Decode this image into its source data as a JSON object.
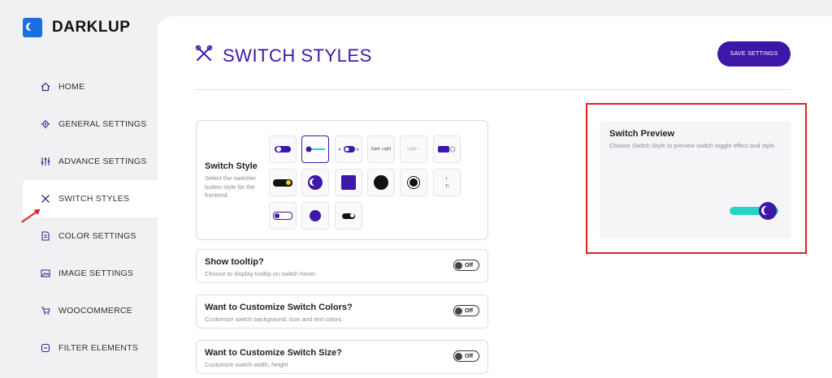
{
  "brand": {
    "name": "DARKLUP",
    "accent": "#3d17a8",
    "logo_color": "#1a6fe0"
  },
  "sidebar": {
    "items": [
      {
        "label": "HOME",
        "icon": "home-icon"
      },
      {
        "label": "GENERAL SETTINGS",
        "icon": "gear-icon"
      },
      {
        "label": "ADVANCE SETTINGS",
        "icon": "sliders-icon"
      },
      {
        "label": "SWITCH STYLES",
        "icon": "tools-icon",
        "active": true
      },
      {
        "label": "COLOR SETTINGS",
        "icon": "palette-icon"
      },
      {
        "label": "IMAGE SETTINGS",
        "icon": "image-icon"
      },
      {
        "label": "WOOCOMMERCE",
        "icon": "cart-icon"
      },
      {
        "label": "FILTER ELEMENTS",
        "icon": "filter-icon"
      }
    ]
  },
  "header": {
    "title": "SWITCH STYLES",
    "save_label": "SAVE SETTINGS"
  },
  "switch_style": {
    "title": "Switch Style",
    "description": "Select the switcher button style for the frontend.",
    "options_text": {
      "dark": "Dark",
      "light": "Light",
      "light2": "Light",
      "tr": "Tr"
    }
  },
  "toggles": [
    {
      "title": "Show tooltip?",
      "description": "Choose to display tooltip on switch hover.",
      "state": "Off"
    },
    {
      "title": "Want to Customize Switch Colors?",
      "description": "Customize switch background, icon and text colors",
      "state": "Off"
    },
    {
      "title": "Want to Customize Switch Size?",
      "description": "Customize switch width, height",
      "state": "Off"
    }
  ],
  "preview": {
    "title": "Switch Preview",
    "description": "Choose Switch Style to preview switch toggle effect and style.",
    "track_color": "#23d6c3"
  },
  "annotation_color": "#dd2222"
}
